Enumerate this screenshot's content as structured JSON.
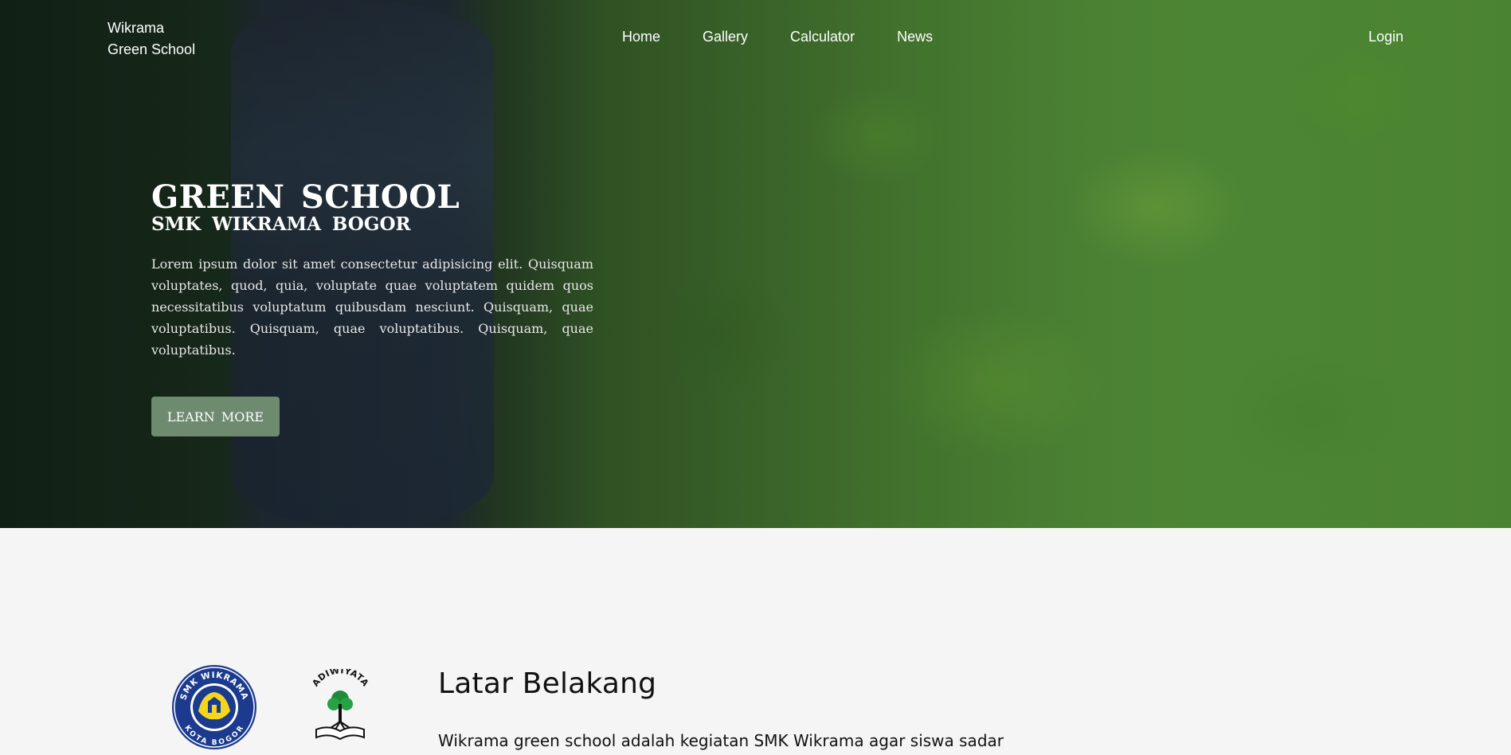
{
  "brand": {
    "line1": "Wikrama",
    "line2": "Green School"
  },
  "nav": {
    "items": [
      "Home",
      "Gallery",
      "Calculator",
      "News"
    ],
    "login": "Login"
  },
  "hero": {
    "title": "GREEN SCHOOL",
    "subtitle": "SMK WIKRAMA BOGOR",
    "text": "Lorem ipsum dolor sit amet consectetur adipisicing elit. Quisquam voluptates, quod, quia, voluptate quae voluptatem quidem quos necessitatibus voluptatum quibusdam nesciunt. Quisquam, quae voluptatibus. Quisquam, quae voluptatibus. Quisquam, quae voluptatibus.",
    "button": "LEARN MORE"
  },
  "logos": {
    "wikrama_top": "SMK WIKRAMA",
    "wikrama_bottom": "KOTA BOGOR",
    "adiwiyata": "ADIWIYATA"
  },
  "about": {
    "title": "Latar Belakang",
    "text": "Wikrama green school adalah kegiatan SMK Wikrama agar siswa sadar"
  },
  "colors": {
    "button_bg": "#6e8a6f",
    "page_bg": "#f5f5f5",
    "logo_blue": "#1c3b8f",
    "logo_yellow": "#f4d71d"
  }
}
